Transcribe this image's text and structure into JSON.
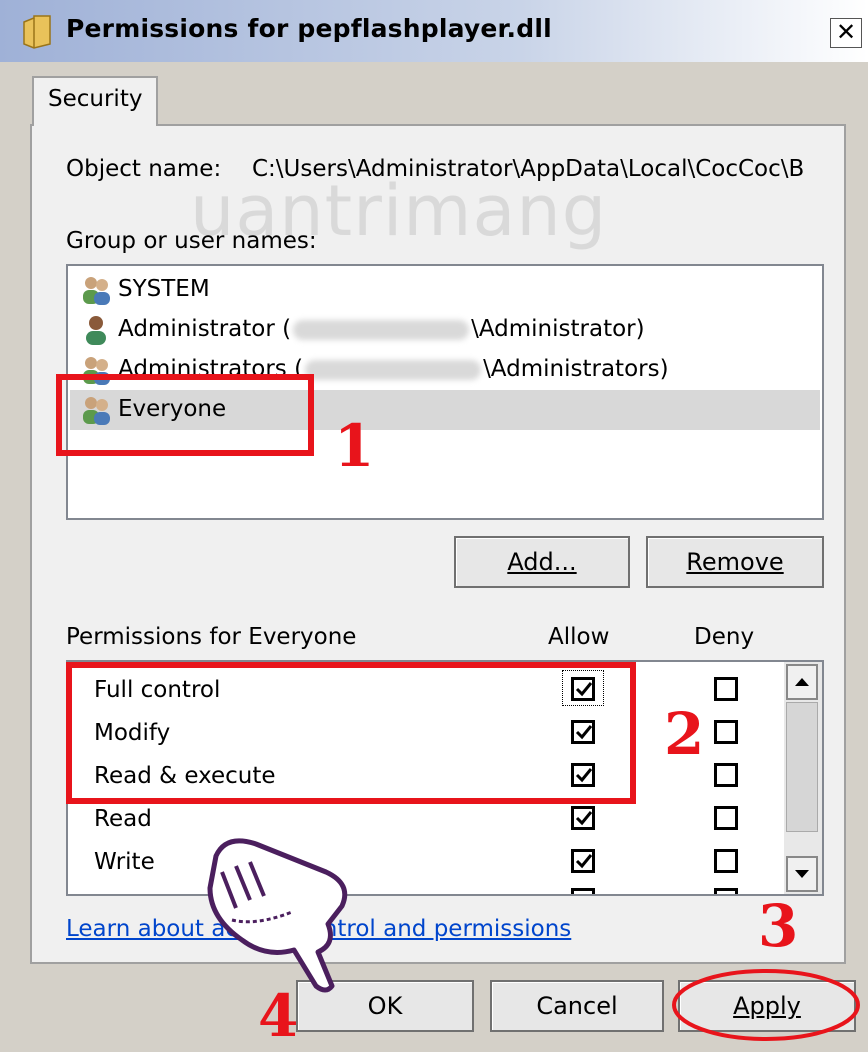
{
  "window": {
    "title": "Permissions for pepflashplayer.dll",
    "close_label": "✕"
  },
  "tabs": [
    {
      "label": "Security"
    }
  ],
  "object": {
    "label": "Object name:",
    "value": "C:\\Users\\Administrator\\AppData\\Local\\CocCoc\\B"
  },
  "groups": {
    "label": "Group or user names:",
    "items": [
      {
        "name": "SYSTEM",
        "icon": "users-icon"
      },
      {
        "name": "Administrator (",
        "suffix": "\\Administrator)",
        "icon": "user-icon"
      },
      {
        "name": "Administrators (",
        "suffix": "\\Administrators)",
        "icon": "users-icon"
      },
      {
        "name": "Everyone",
        "icon": "users-icon",
        "selected": true
      }
    ]
  },
  "buttons": {
    "add": "Add...",
    "remove": "Remove",
    "ok": "OK",
    "cancel": "Cancel",
    "apply": "Apply"
  },
  "permissions": {
    "label": "Permissions for Everyone",
    "allow_header": "Allow",
    "deny_header": "Deny",
    "rows": [
      {
        "name": "Full control",
        "allow": true,
        "deny": false
      },
      {
        "name": "Modify",
        "allow": true,
        "deny": false
      },
      {
        "name": "Read & execute",
        "allow": true,
        "deny": false
      },
      {
        "name": "Read",
        "allow": true,
        "deny": false
      },
      {
        "name": "Write",
        "allow": true,
        "deny": false
      }
    ]
  },
  "link": "Learn about access control and permissions",
  "annotations": {
    "step1": "1",
    "step2": "2",
    "step3": "3",
    "step4": "4",
    "color": "#e8141b"
  },
  "watermark": "uantrimang"
}
